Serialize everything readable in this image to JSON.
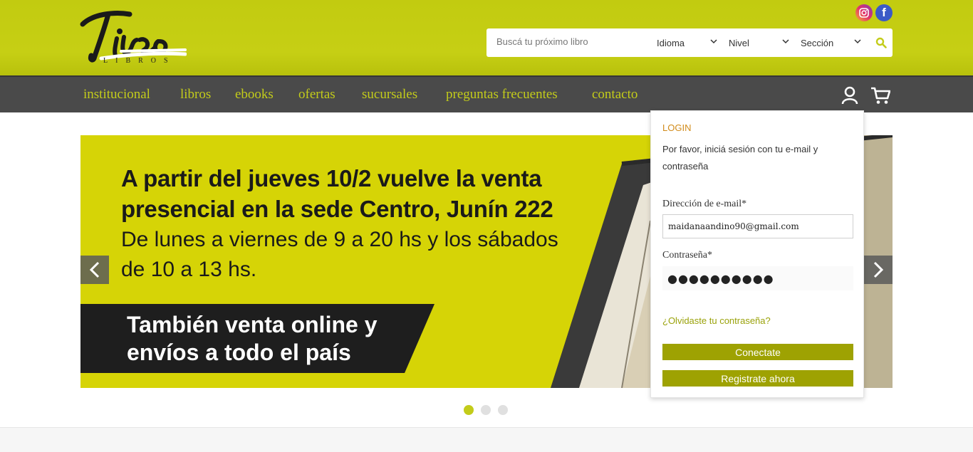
{
  "header": {
    "logo_sub": "LIBROS",
    "search": {
      "placeholder": "Buscá tu próximo libro"
    },
    "filters": [
      {
        "label": "Idioma"
      },
      {
        "label": "Nivel"
      },
      {
        "label": "Sección"
      }
    ],
    "social": {
      "instagram": "instagram-icon",
      "facebook": "f"
    }
  },
  "nav": {
    "items": [
      {
        "label": "institucional"
      },
      {
        "label": "libros"
      },
      {
        "label": "ebooks"
      },
      {
        "label": "ofertas"
      },
      {
        "label": "sucursales"
      },
      {
        "label": "preguntas frecuentes"
      },
      {
        "label": "contacto"
      }
    ]
  },
  "banner": {
    "line1": "A partir del jueves 10/2 vuelve la venta",
    "line2": "presencial en la sede Centro, Junín 222",
    "line3": "De lunes a viernes de 9 a 20 hs y los sábados",
    "line4": "de 10 a 13 hs.",
    "band1": "También venta online y",
    "band2": "envíos  a todo el país"
  },
  "carousel": {
    "slides": 3,
    "active": 1
  },
  "login": {
    "title": "LOGIN",
    "description": "Por favor, iniciá sesión con tu e-mail y contraseña",
    "email_label": "Dirección de e-mail*",
    "email_value": "maidanaandino90@gmail.com",
    "password_label": "Contraseña*",
    "password_value": "●●●●●●●●●●",
    "forgot": "¿Olvidaste tu contraseña?",
    "connect": "Conectate",
    "register": "Registrate ahora"
  },
  "colors": {
    "brand": "#c3cc1a",
    "nav_bg": "#4a4a4a",
    "button": "#9ea202",
    "login_title": "#d18b1a"
  }
}
